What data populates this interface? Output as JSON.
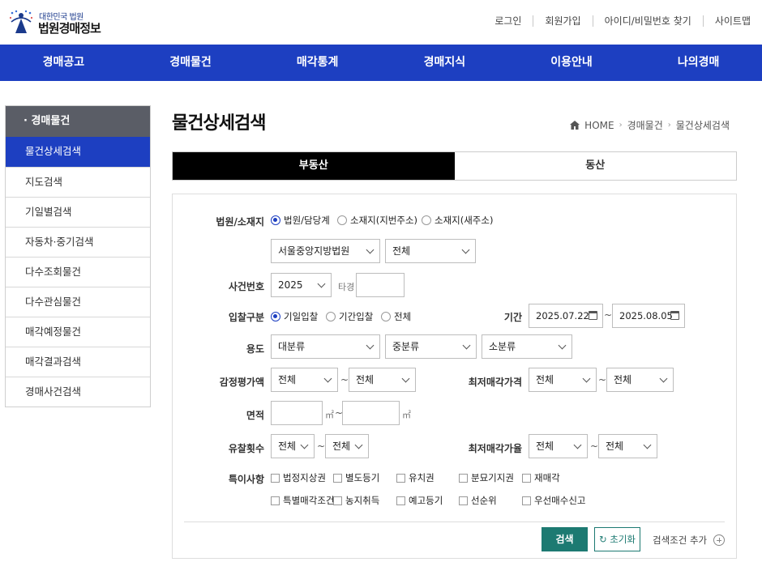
{
  "header": {
    "logo_small": "대한민국 법원",
    "logo_title": "법원경매정보",
    "util_links": [
      "로그인",
      "회원가입",
      "아이디/비밀번호 찾기",
      "사이트맵"
    ]
  },
  "gnb": [
    "경매공고",
    "경매물건",
    "매각통계",
    "경매지식",
    "이용안내",
    "나의경매"
  ],
  "sidebar": {
    "title": "· 경매물건",
    "items": [
      {
        "label": "물건상세검색",
        "active": true
      },
      {
        "label": "지도검색",
        "active": false
      },
      {
        "label": "기일별검색",
        "active": false
      },
      {
        "label": "자동차·중기검색",
        "active": false
      },
      {
        "label": "다수조회물건",
        "active": false
      },
      {
        "label": "다수관심물건",
        "active": false
      },
      {
        "label": "매각예정물건",
        "active": false
      },
      {
        "label": "매각결과검색",
        "active": false
      },
      {
        "label": "경매사건검색",
        "active": false
      }
    ]
  },
  "page": {
    "title": "물건상세검색",
    "breadcrumb": [
      "HOME",
      "경매물건",
      "물건상세검색"
    ]
  },
  "tabs": [
    {
      "label": "부동산",
      "active": true
    },
    {
      "label": "동산",
      "active": false
    }
  ],
  "form": {
    "court": {
      "label": "법원/소재지",
      "options": [
        "법원/담당계",
        "소재지(지번주소)",
        "소재지(새주소)"
      ],
      "selected_index": 0,
      "court_select": "서울중앙지방법원",
      "dept_select": "전체"
    },
    "case_no": {
      "label": "사건번호",
      "year": "2025",
      "type_label": "타경",
      "number": ""
    },
    "bid_type": {
      "label": "입찰구분",
      "options": [
        "기일입찰",
        "기간입찰",
        "전체"
      ],
      "selected_index": 0
    },
    "period": {
      "label": "기간",
      "from": "2025.07.22",
      "to": "2025.08.05",
      "tilde": "~"
    },
    "usage": {
      "label": "용도",
      "major": "대분류",
      "middle": "중분류",
      "minor": "소분류"
    },
    "appraisal": {
      "label": "감정평가액",
      "from": "전체",
      "to": "전체"
    },
    "min_price": {
      "label": "최저매각가격",
      "from": "전체",
      "to": "전체"
    },
    "area": {
      "label": "면적",
      "unit": "㎡",
      "from": "",
      "to": ""
    },
    "fail_count": {
      "label": "유찰횟수",
      "from": "전체",
      "to": "전체"
    },
    "min_rate": {
      "label": "최저매각가율",
      "from": "전체",
      "to": "전체"
    },
    "special": {
      "label": "특이사항",
      "items_row1": [
        "법정지상권",
        "별도등기",
        "유치권",
        "분묘기지권",
        "재매각"
      ],
      "items_row2": [
        "특별매각조건",
        "농지취득",
        "예고등기",
        "선순위",
        "우선매수신고"
      ]
    },
    "buttons": {
      "search": "검색",
      "reset": "초기화",
      "more": "검색조건 추가"
    }
  }
}
